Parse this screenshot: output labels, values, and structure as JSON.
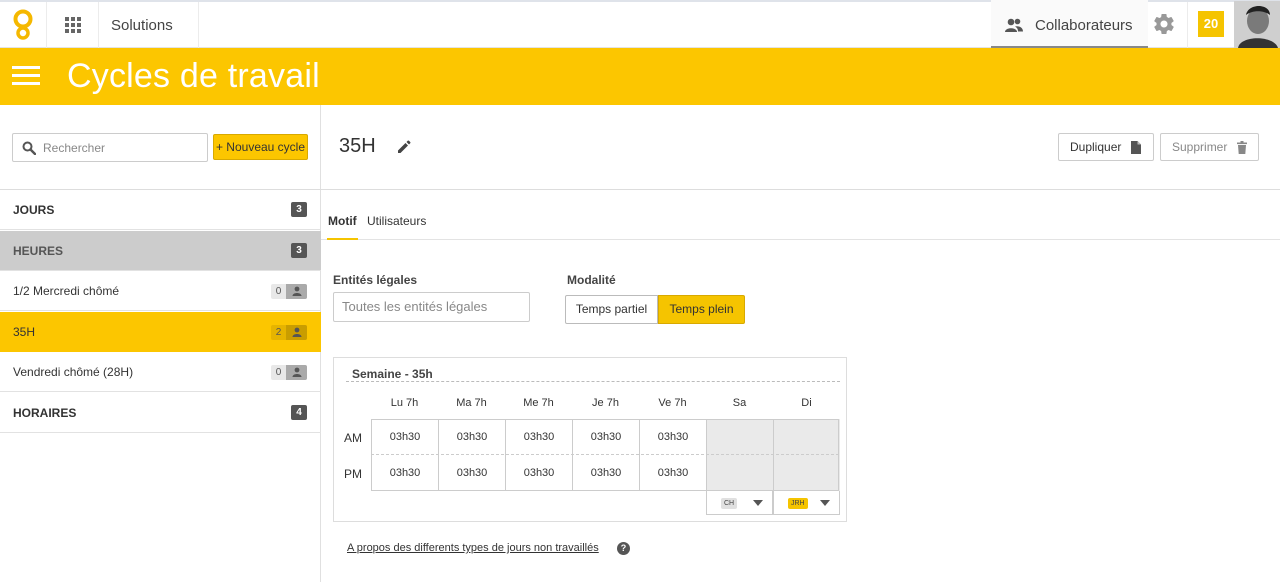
{
  "topbar": {
    "solutions_label": "Solutions",
    "collaborateurs_label": "Collaborateurs",
    "notification_count": "20"
  },
  "header": {
    "title": "Cycles de travail"
  },
  "sidebar": {
    "search_placeholder": "Rechercher",
    "new_cycle_label": "+ Nouveau cycle",
    "categories": [
      {
        "label": "JOURS",
        "count": "3"
      },
      {
        "label": "HEURES",
        "count": "3"
      },
      {
        "label": "HORAIRES",
        "count": "4"
      }
    ],
    "items": [
      {
        "label": "1/2 Mercredi chômé",
        "users": "0"
      },
      {
        "label": "35H",
        "users": "2",
        "selected": true
      },
      {
        "label": "Vendredi chômé (28H)",
        "users": "0"
      }
    ]
  },
  "detail": {
    "title": "35H",
    "duplicate_label": "Dupliquer",
    "delete_label": "Supprimer",
    "tabs": [
      {
        "label": "Motif",
        "active": true
      },
      {
        "label": "Utilisateurs"
      }
    ],
    "entities": {
      "label": "Entités légales",
      "placeholder": "Toutes les entités légales"
    },
    "modality": {
      "label": "Modalité",
      "options": [
        "Temps partiel",
        "Temps plein"
      ],
      "selected": "Temps plein"
    },
    "week": {
      "title": "Semaine - 35h",
      "days": [
        "Lu 7h",
        "Ma 7h",
        "Me 7h",
        "Je 7h",
        "Ve 7h",
        "Sa",
        "Di"
      ],
      "rows": [
        {
          "label": "AM",
          "values": [
            "03h30",
            "03h30",
            "03h30",
            "03h30",
            "03h30",
            "",
            ""
          ]
        },
        {
          "label": "PM",
          "values": [
            "03h30",
            "03h30",
            "03h30",
            "03h30",
            "03h30",
            "",
            ""
          ]
        }
      ],
      "off_tags": [
        {
          "label": "CH",
          "color": "#e0e0e0"
        },
        {
          "label": "JRH",
          "color": "#f5c400"
        }
      ]
    },
    "about_link": "A propos des differents types de jours non travaillés"
  },
  "colors": {
    "accent": "#fcc600",
    "selected_row": "#fcc600",
    "category_selected": "#cccccc"
  }
}
